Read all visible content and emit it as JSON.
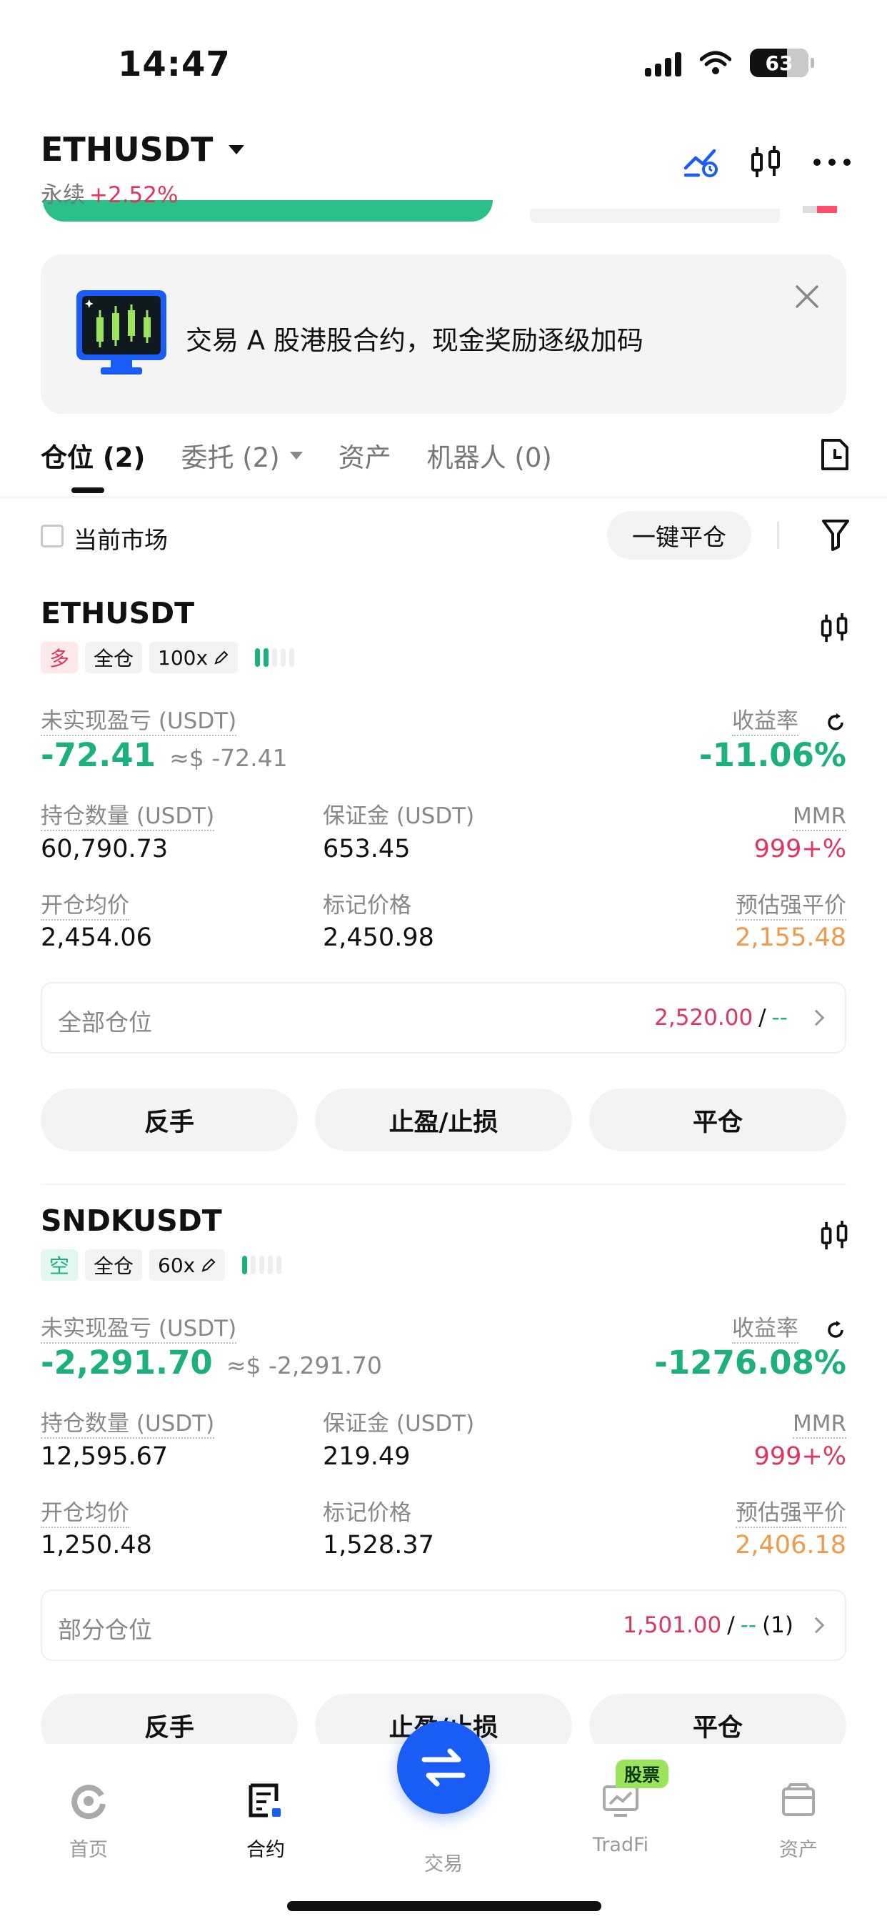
{
  "status": {
    "time": "14:47",
    "battery": "63"
  },
  "header": {
    "symbol": "ETHUSDT",
    "type": "永续",
    "change": "+2.52%"
  },
  "banner": {
    "text": "交易 A 股港股合约，现金奖励逐级加码"
  },
  "tabs": [
    {
      "label": "仓位 (2)"
    },
    {
      "label": "委托 (2)"
    },
    {
      "label": "资产"
    },
    {
      "label": "机器人 (0)"
    }
  ],
  "filter": {
    "current_market": "当前市场",
    "close_all": "一键平仓"
  },
  "labels": {
    "unrealized": "未实现盈亏 (USDT)",
    "roi": "收益率",
    "size": "持仓数量 (USDT)",
    "margin": "保证金 (USDT)",
    "mmr": "MMR",
    "entry": "开仓均价",
    "mark": "标记价格",
    "liq": "预估强平价",
    "reverse": "反手",
    "tpsl": "止盈/止损",
    "close": "平仓"
  },
  "positions": [
    {
      "symbol": "ETHUSDT",
      "side": "多",
      "mode": "全仓",
      "leverage": "100x",
      "pnl": "-72.41",
      "pnl_usd": "≈$ -72.41",
      "roi": "-11.06%",
      "size": "60,790.73",
      "margin": "653.45",
      "mmr": "999+%",
      "entry": "2,454.06",
      "mark": "2,450.98",
      "liq": "2,155.48",
      "tpsl_label": "全部仓位",
      "tpsl_tp": "2,520.00",
      "tpsl_sep": "/",
      "tpsl_sl": "--",
      "tpsl_count": ""
    },
    {
      "symbol": "SNDKUSDT",
      "side": "空",
      "mode": "全仓",
      "leverage": "60x",
      "pnl": "-2,291.70",
      "pnl_usd": "≈$ -2,291.70",
      "roi": "-1276.08%",
      "size": "12,595.67",
      "margin": "219.49",
      "mmr": "999+%",
      "entry": "1,250.48",
      "mark": "1,528.37",
      "liq": "2,406.18",
      "tpsl_label": "部分仓位",
      "tpsl_tp": "1,501.00",
      "tpsl_sep": "/",
      "tpsl_sl": "--",
      "tpsl_count": "(1)"
    }
  ],
  "nav": {
    "home": "首页",
    "futures": "合约",
    "trade": "交易",
    "tradfi": "TradFi",
    "assets": "资产",
    "stock_badge": "股票"
  },
  "colors": {
    "green": "#1cb07a",
    "red": "#e0365c",
    "orange": "#f2994a",
    "blue": "#1a5cf6"
  }
}
